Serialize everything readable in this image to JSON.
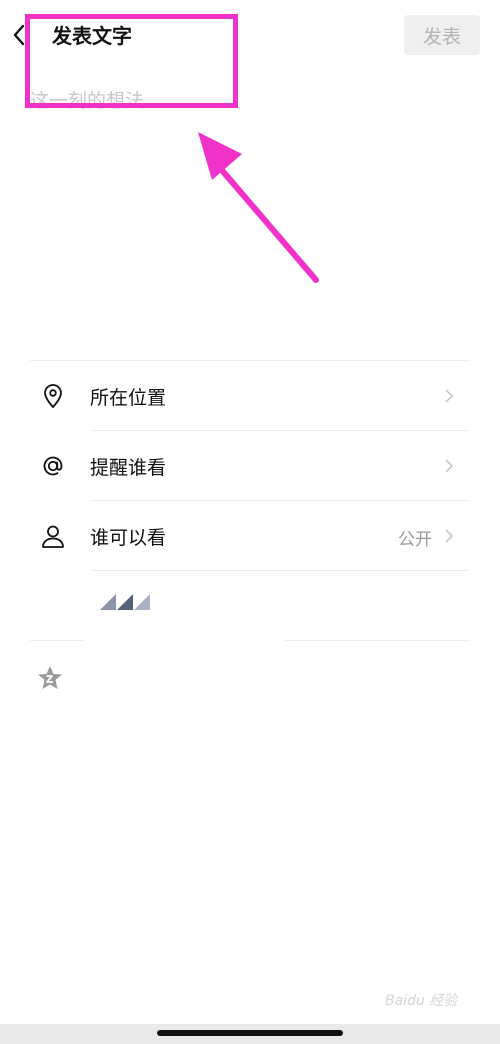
{
  "header": {
    "title": "发表文字",
    "publish_label": "发表"
  },
  "compose": {
    "placeholder": "这一刻的想法..."
  },
  "options": [
    {
      "label": "所在位置",
      "icon": "location-pin-icon"
    },
    {
      "label": "提醒谁看",
      "icon": "at-sign-icon"
    },
    {
      "label": "谁可以看",
      "icon": "person-icon",
      "value": "公开"
    }
  ],
  "watermark": "Baidu 经验",
  "colors": {
    "annotation": "#f032c8",
    "publish_disabled_bg": "#efefef",
    "publish_disabled_text": "#b3b3b3"
  }
}
